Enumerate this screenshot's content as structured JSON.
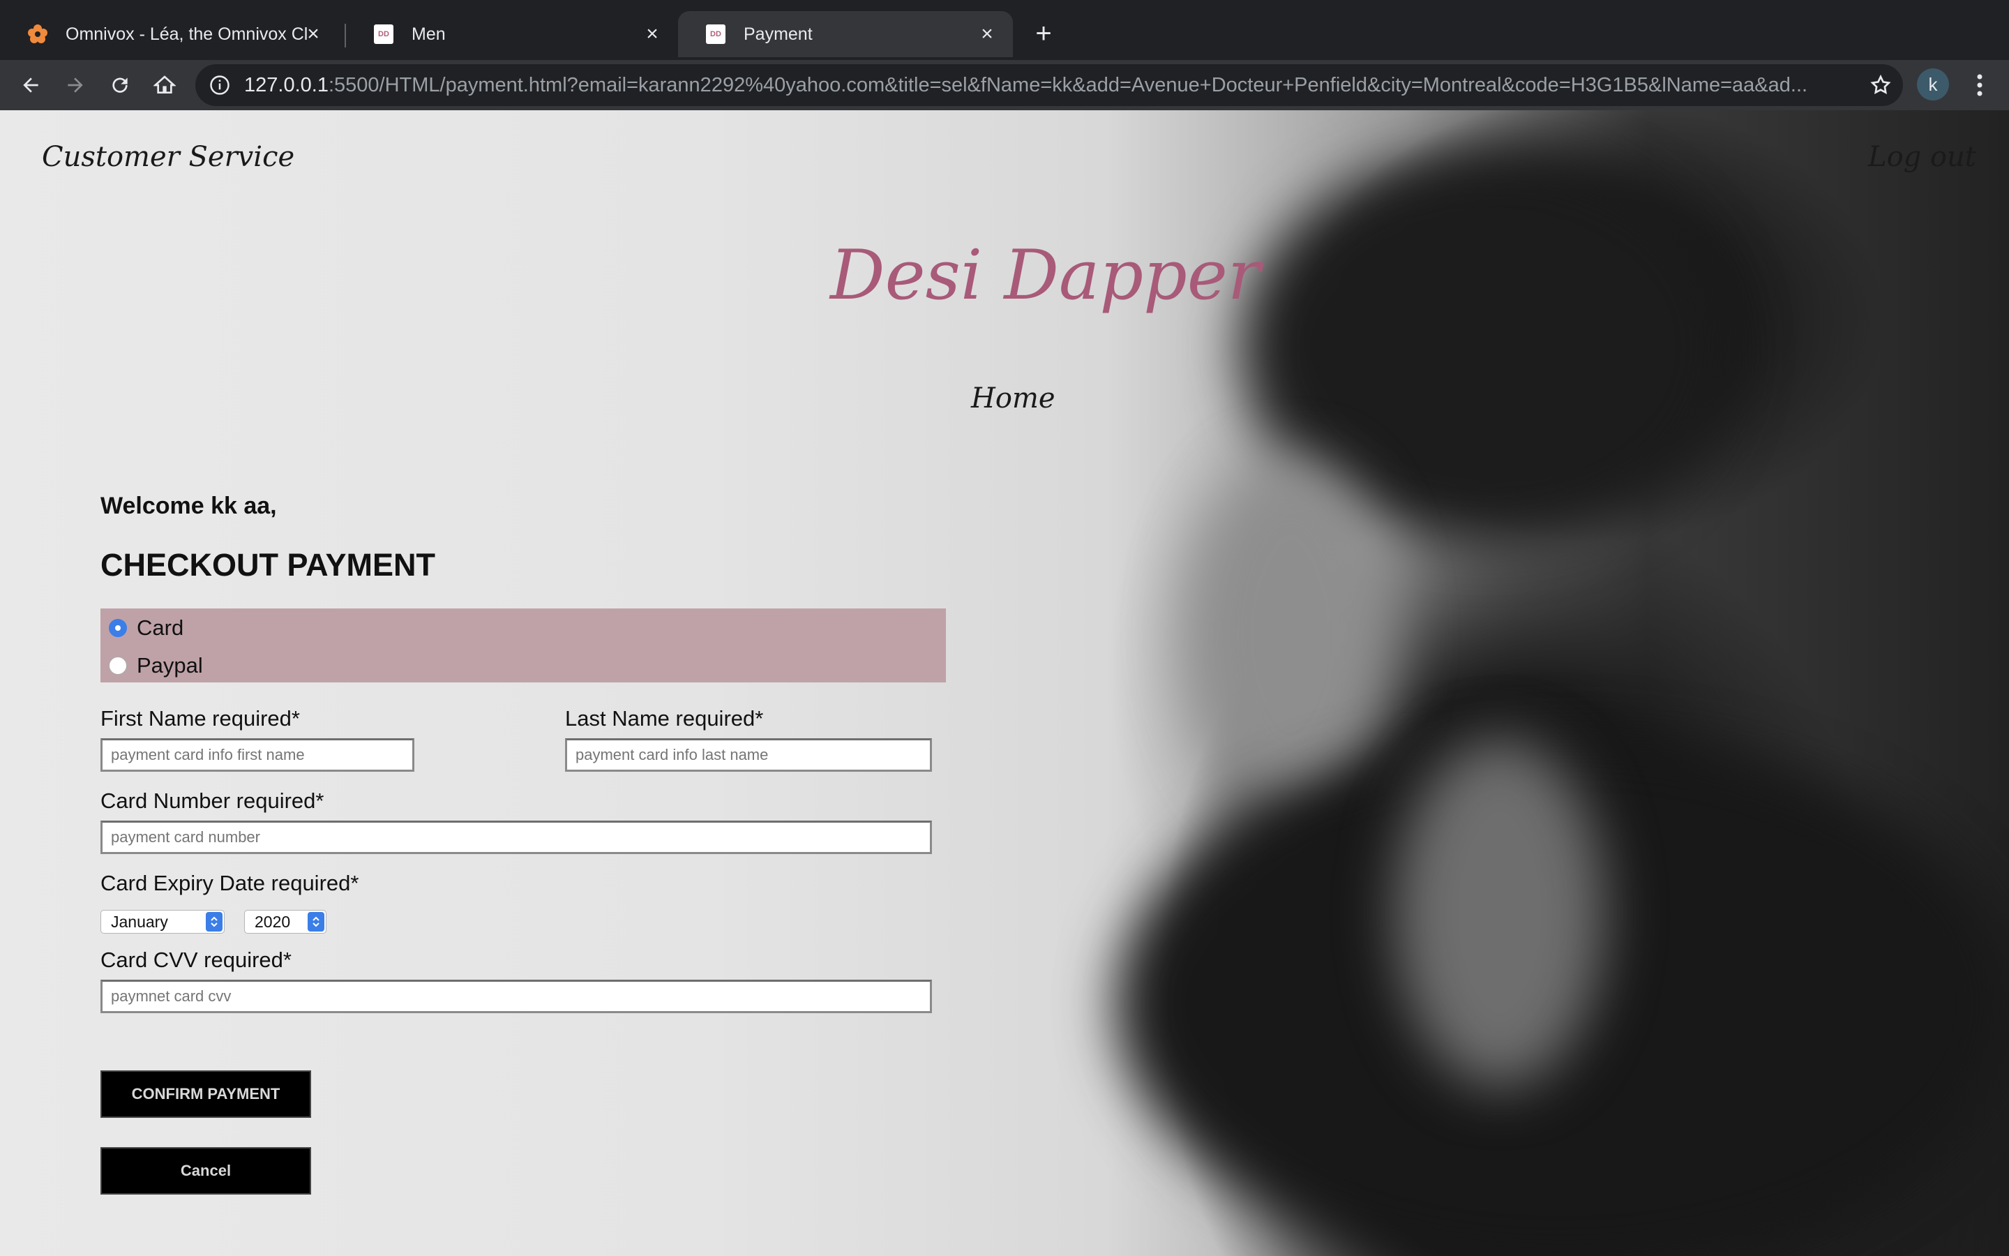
{
  "browser": {
    "tabs": [
      {
        "title": "Omnivox - Léa, the Omnivox Cl",
        "favicon": "omnivox-flower-icon"
      },
      {
        "title": "Men",
        "favicon": "desi-dapper-favicon"
      },
      {
        "title": "Payment",
        "favicon": "desi-dapper-favicon",
        "active": true
      }
    ],
    "favicon_text": "DD",
    "url_host": "127.0.0.1",
    "url_rest": ":5500/HTML/payment.html?email=karann2292%40yahoo.com&title=sel&fName=kk&add=Avenue+Docteur+Penfield&city=Montreal&code=H3G1B5&lName=aa&ad...",
    "profile_initial": "k"
  },
  "page": {
    "nav": {
      "customer_service": "Customer Service",
      "logout": "Log out",
      "brand": "Desi Dapper",
      "home": "Home"
    },
    "welcome": "Welcome kk aa,",
    "heading": "CHECKOUT PAYMENT",
    "payment_methods": {
      "options": [
        "Card",
        "Paypal"
      ],
      "selected": "Card"
    },
    "form": {
      "first_name_label": "First Name required*",
      "first_name_placeholder": "payment card info first name",
      "last_name_label": "Last Name required*",
      "last_name_placeholder": "payment card info last name",
      "card_number_label": "Card Number required*",
      "card_number_placeholder": "payment card number",
      "expiry_label": "Card Expiry Date required*",
      "expiry_month": "January",
      "expiry_year": "2020",
      "cvv_label": "Card CVV required*",
      "cvv_placeholder": "paymnet card cvv"
    },
    "buttons": {
      "confirm": "CONFIRM PAYMENT",
      "cancel": "Cancel"
    }
  },
  "colors": {
    "brand": "#a85a78",
    "method_box": "#bfa2a8",
    "radio_selected": "#3b7ee8"
  }
}
